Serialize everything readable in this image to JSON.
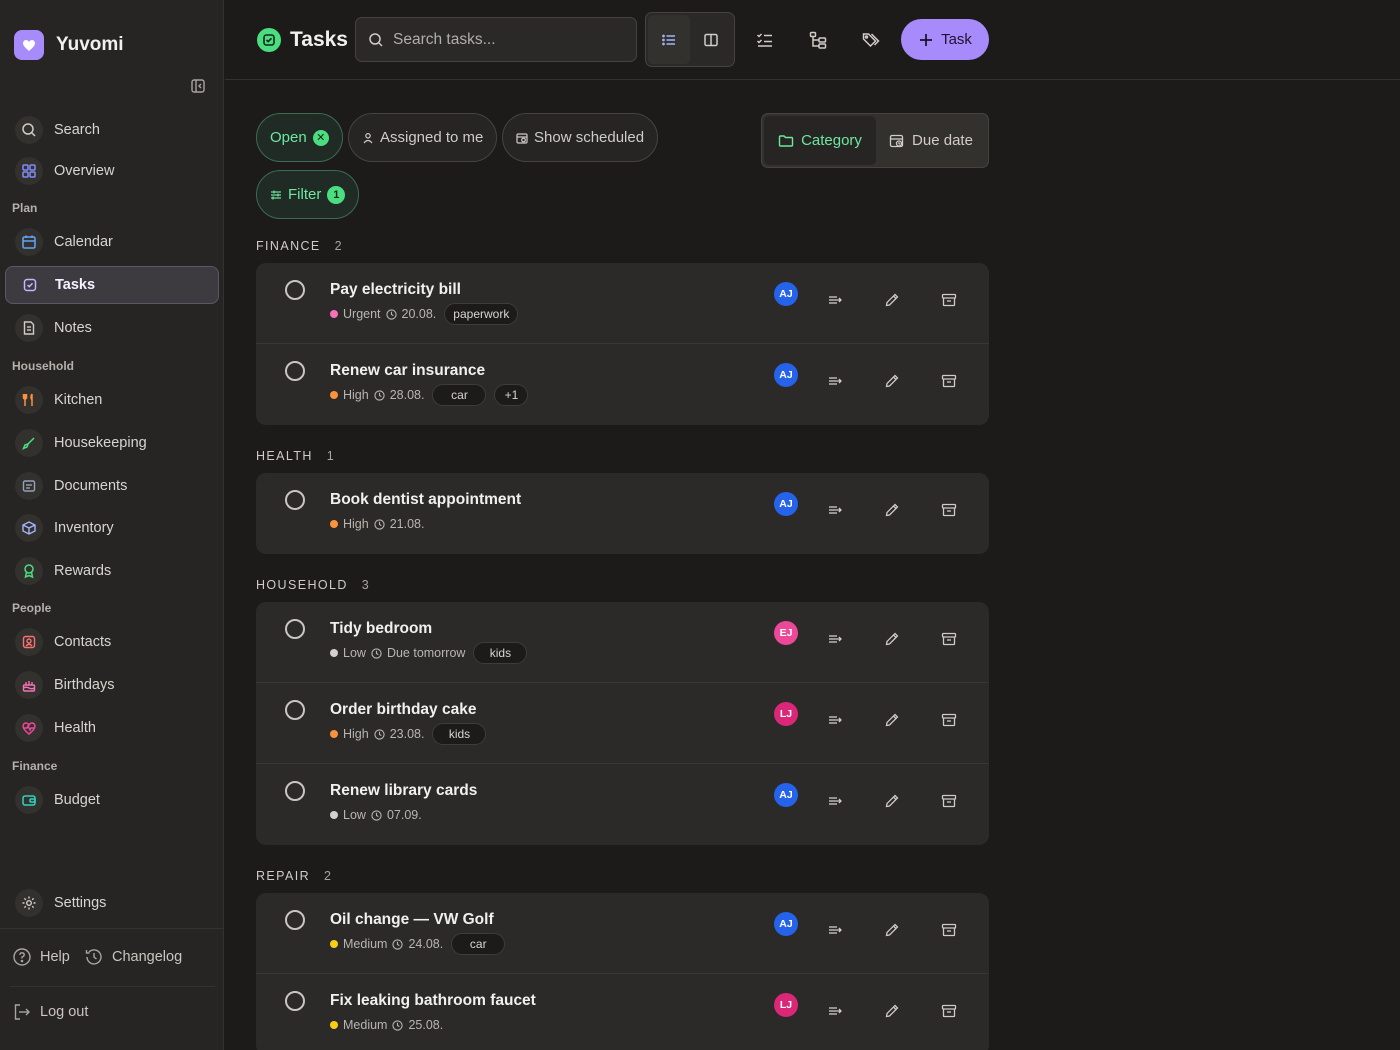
{
  "app": {
    "name": "Yuvomi"
  },
  "sidebar": {
    "collapse_icon": "sidebar-collapse-icon",
    "top_items": [
      {
        "label": "Search",
        "icon": "search-icon"
      },
      {
        "label": "Overview",
        "icon": "grid-icon"
      }
    ],
    "sections": [
      {
        "label": "Plan",
        "items": [
          {
            "label": "Calendar",
            "icon": "calendar-icon"
          },
          {
            "label": "Tasks",
            "icon": "check-square-icon",
            "active": true
          },
          {
            "label": "Notes",
            "icon": "note-icon"
          }
        ]
      },
      {
        "label": "Household",
        "items": [
          {
            "label": "Kitchen",
            "icon": "utensils-icon"
          },
          {
            "label": "Housekeeping",
            "icon": "brush-icon"
          },
          {
            "label": "Documents",
            "icon": "document-icon"
          },
          {
            "label": "Inventory",
            "icon": "box-icon"
          },
          {
            "label": "Rewards",
            "icon": "award-icon"
          }
        ]
      },
      {
        "label": "People",
        "items": [
          {
            "label": "Contacts",
            "icon": "contacts-icon"
          },
          {
            "label": "Birthdays",
            "icon": "cake-icon"
          },
          {
            "label": "Health",
            "icon": "heart-pulse-icon"
          }
        ]
      },
      {
        "label": "Finance",
        "items": [
          {
            "label": "Budget",
            "icon": "wallet-icon"
          }
        ]
      }
    ],
    "settings_label": "Settings",
    "help_label": "Help",
    "changelog_label": "Changelog",
    "logout_label": "Log out"
  },
  "header": {
    "title": "Tasks",
    "search_placeholder": "Search tasks...",
    "add_label": "Task",
    "tools": [
      "checklist-icon",
      "hierarchy-icon",
      "tags-icon"
    ]
  },
  "filters": {
    "open_label": "Open",
    "assigned_label": "Assigned to me",
    "scheduled_label": "Show scheduled",
    "filter_label": "Filter",
    "filter_count": "1",
    "group_category": "Category",
    "group_due": "Due date"
  },
  "groups": [
    {
      "name": "FINANCE",
      "count": "2",
      "tasks": [
        {
          "title": "Pay electricity bill",
          "priority": "Urgent",
          "priority_color": "#f472b6",
          "date": "20.08.",
          "tags": [
            "paperwork"
          ],
          "more": "",
          "assignee": "AJ",
          "avatar_color": "#2563eb"
        },
        {
          "title": "Renew car insurance",
          "priority": "High",
          "priority_color": "#fb923c",
          "date": "28.08.",
          "tags": [
            "car"
          ],
          "more": "+1",
          "assignee": "AJ",
          "avatar_color": "#2563eb"
        }
      ]
    },
    {
      "name": "HEALTH",
      "count": "1",
      "tasks": [
        {
          "title": "Book dentist appointment",
          "priority": "High",
          "priority_color": "#fb923c",
          "date": "21.08.",
          "tags": [],
          "more": "",
          "assignee": "AJ",
          "avatar_color": "#2563eb"
        }
      ]
    },
    {
      "name": "HOUSEHOLD",
      "count": "3",
      "tasks": [
        {
          "title": "Tidy bedroom",
          "priority": "Low",
          "priority_color": "#d4d0cb",
          "date": "Due tomorrow",
          "tags": [
            "kids"
          ],
          "more": "",
          "assignee": "EJ",
          "avatar_color": "#ec4899"
        },
        {
          "title": "Order birthday cake",
          "priority": "High",
          "priority_color": "#fb923c",
          "date": "23.08.",
          "tags": [
            "kids"
          ],
          "more": "",
          "assignee": "LJ",
          "avatar_color": "#db2777"
        },
        {
          "title": "Renew library cards",
          "priority": "Low",
          "priority_color": "#d4d0cb",
          "date": "07.09.",
          "tags": [],
          "more": "",
          "assignee": "AJ",
          "avatar_color": "#2563eb"
        }
      ]
    },
    {
      "name": "REPAIR",
      "count": "2",
      "tasks": [
        {
          "title": "Oil change — VW Golf",
          "priority": "Medium",
          "priority_color": "#facc15",
          "date": "24.08.",
          "tags": [
            "car"
          ],
          "more": "",
          "assignee": "AJ",
          "avatar_color": "#2563eb"
        },
        {
          "title": "Fix leaking bathroom faucet",
          "priority": "Medium",
          "priority_color": "#facc15",
          "date": "25.08.",
          "tags": [],
          "more": "",
          "assignee": "LJ",
          "avatar_color": "#db2777"
        }
      ]
    }
  ],
  "colors": {
    "accent": "#a78bfa",
    "success": "#4ade80",
    "background": "#1c1b1a"
  }
}
